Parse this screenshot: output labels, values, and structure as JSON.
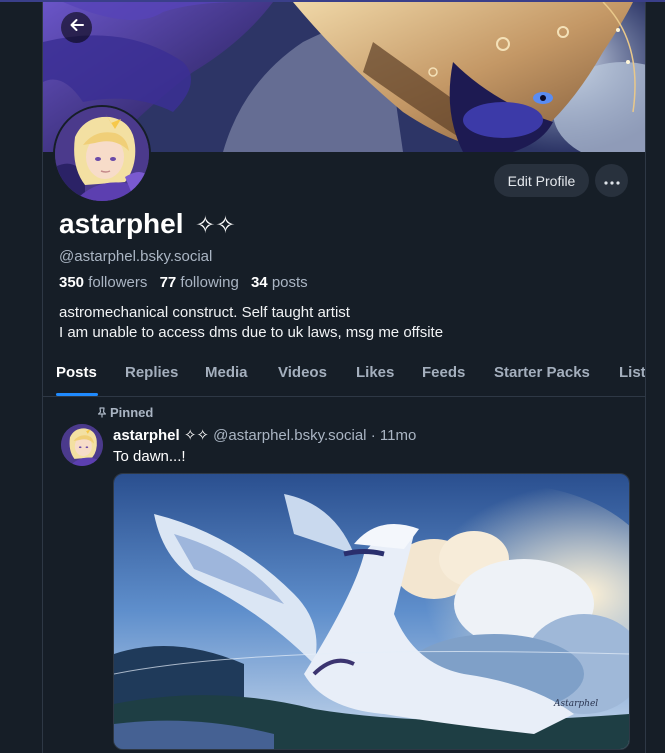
{
  "profile": {
    "display_name": "astarphel",
    "name_sparkles": "✧✧",
    "handle": "@astarphel.bsky.social",
    "followers_count": "350",
    "followers_label": "followers",
    "following_count": "77",
    "following_label": "following",
    "posts_count": "34",
    "posts_label": "posts",
    "bio_line1": "astromechanical construct. Self taught artist",
    "bio_line2": "I am unable to access dms due to uk laws, msg me offsite"
  },
  "actions": {
    "edit_profile": "Edit Profile",
    "more": "···"
  },
  "tabs": [
    "Posts",
    "Replies",
    "Media",
    "Videos",
    "Likes",
    "Feeds",
    "Starter Packs",
    "List"
  ],
  "active_tab": "Posts",
  "post": {
    "pinned_label": "Pinned",
    "author_name": "astarphel ✧✧",
    "author_handle": "@astarphel.bsky.social",
    "separator": "·",
    "time": "11mo",
    "text": "To dawn...!"
  },
  "icons": {
    "back": "arrow-left-icon",
    "more": "ellipsis-icon",
    "pinned": "pin-icon"
  },
  "colors": {
    "background": "#161e27",
    "accent": "#208bfe",
    "button_bg": "#28313d",
    "muted_text": "#aab5c3"
  }
}
